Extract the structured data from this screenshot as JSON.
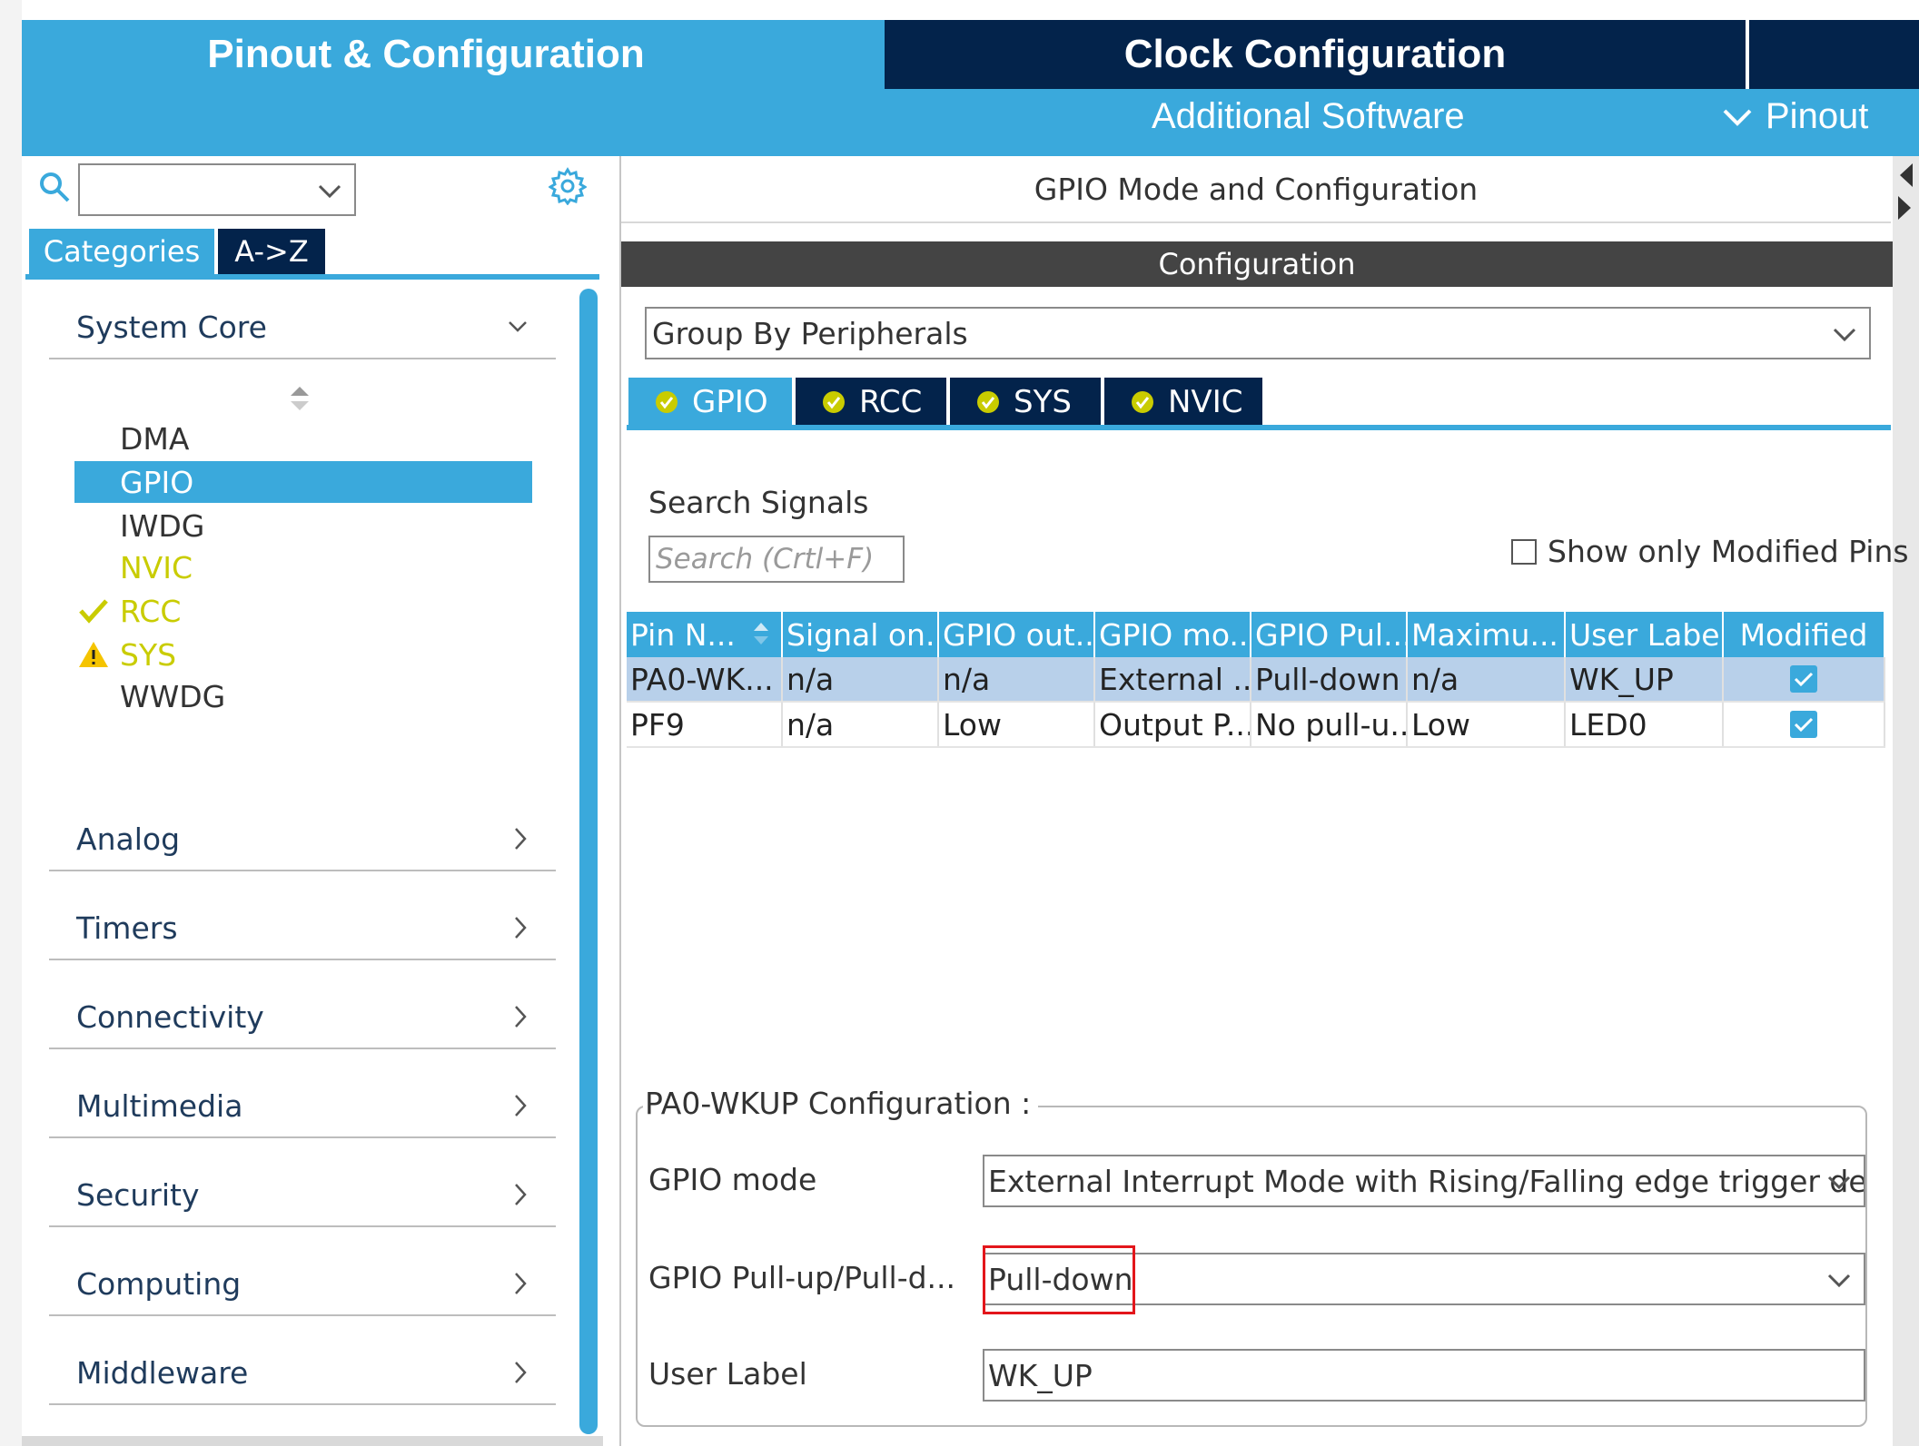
{
  "top_tabs": {
    "pinout": "Pinout & Configuration",
    "clock": "Clock Configuration",
    "additional": "Additional Software",
    "pinout_view": "Pinout"
  },
  "left": {
    "categories_tab": "Categories",
    "az_tab": "A->Z",
    "system_core": "System Core",
    "peripherals": [
      {
        "label": "DMA",
        "state": "normal"
      },
      {
        "label": "GPIO",
        "state": "selected"
      },
      {
        "label": "IWDG",
        "state": "normal"
      },
      {
        "label": "NVIC",
        "state": "yellow"
      },
      {
        "label": "RCC",
        "state": "check"
      },
      {
        "label": "SYS",
        "state": "warning"
      },
      {
        "label": "WWDG",
        "state": "normal"
      }
    ],
    "sections": [
      "Analog",
      "Timers",
      "Connectivity",
      "Multimedia",
      "Security",
      "Computing",
      "Middleware"
    ]
  },
  "right": {
    "header": "GPIO Mode and Configuration",
    "config_bar": "Configuration",
    "group_by": "Group By Peripherals",
    "tabs": [
      "GPIO",
      "RCC",
      "SYS",
      "NVIC"
    ],
    "search_label": "Search Signals",
    "search_placeholder": "Search (Crtl+F)",
    "show_modified": "Show only Modified Pins",
    "table": {
      "headers": [
        "Pin N...",
        "Signal on...",
        "GPIO out...",
        "GPIO mo...",
        "GPIO Pul...",
        "Maximu...",
        "User Label",
        "Modified"
      ],
      "rows": [
        [
          "PA0-WK...",
          "n/a",
          "n/a",
          "External ...",
          "Pull-down",
          "n/a",
          "WK_UP"
        ],
        [
          "PF9",
          "n/a",
          "Low",
          "Output P...",
          "No pull-u...",
          "Low",
          "LED0"
        ]
      ],
      "modified": [
        true,
        true
      ]
    },
    "pin_config": {
      "legend": "PA0-WKUP Configuration :",
      "gpio_mode_label": "GPIO mode",
      "gpio_mode_value": "External Interrupt Mode with Rising/Falling edge trigger detec...",
      "pull_label": "GPIO Pull-up/Pull-d...",
      "pull_value": "Pull-down",
      "user_label_label": "User Label",
      "user_label_value": "WK_UP"
    }
  },
  "colors": {
    "accent": "#3aa9dc",
    "navy": "#03234b",
    "config_bar": "#444444",
    "selected_row": "#b8d0ea",
    "nvic_yellow": "#c9cc00",
    "highlight_red": "#e3161b"
  }
}
